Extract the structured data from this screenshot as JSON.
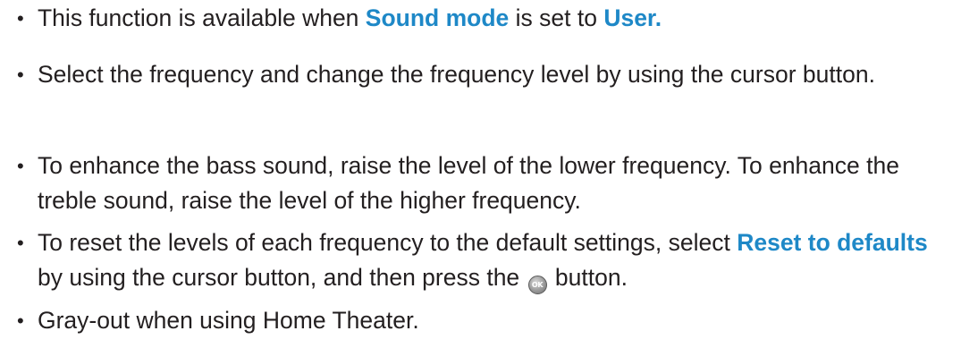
{
  "bullets": {
    "symbol": "•",
    "item1": {
      "pre": "This function is available when ",
      "link1": "Sound mode",
      "mid": " is set to ",
      "link2": "User",
      "post": "."
    },
    "item2": {
      "text": "Select the frequency and change the frequency level by using the cursor button."
    },
    "item3": {
      "text": "To enhance the bass sound, raise the level of the lower frequency. To enhance the treble sound, raise the level of the higher frequency."
    },
    "item4": {
      "pre": "To reset the levels of each frequency to the default settings, select ",
      "link": "Reset to defaults",
      "mid": " by using the cursor button, and then press the ",
      "icon_name": "ok-button-icon",
      "icon_text": "OK",
      "post": " button."
    },
    "item5": {
      "text": "Gray-out when using Home Theater."
    }
  },
  "colors": {
    "text": "#231f20",
    "highlight": "#1e88c7"
  }
}
